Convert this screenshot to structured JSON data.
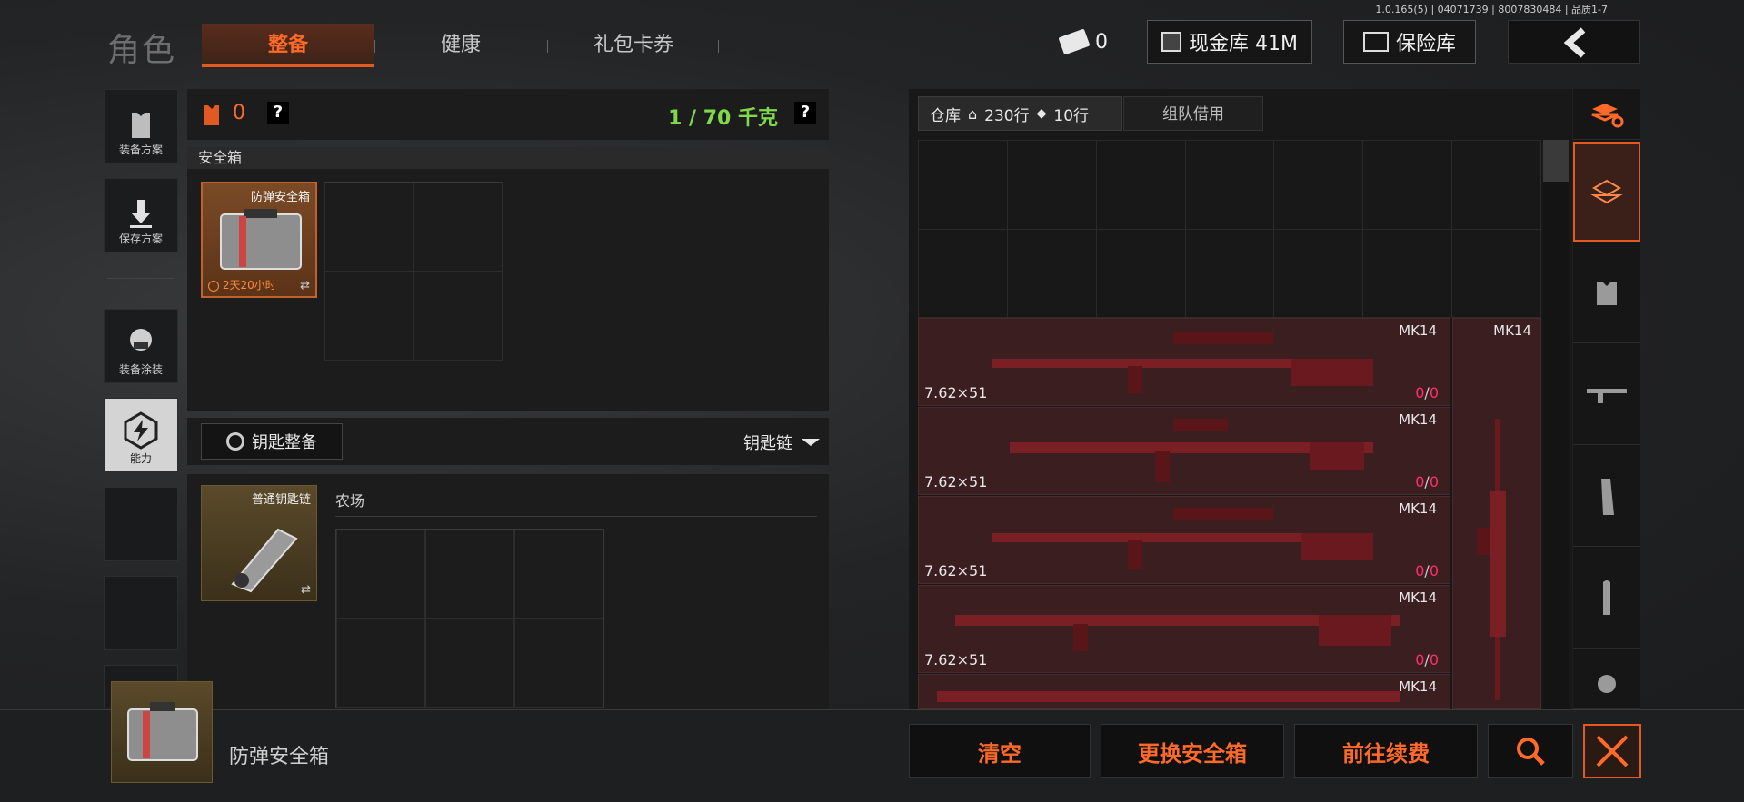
{
  "version_text": "1.0.165(5) | 04071739 | 8007830484 | 品质1-7",
  "header": {
    "role_title": "角色",
    "tabs": [
      "整备",
      "健康",
      "礼包卡券"
    ],
    "ticket_count": "0",
    "cash_label": "现金库 41M",
    "vault_label": "保险库"
  },
  "sidebar": {
    "items": [
      {
        "label": "装备方案",
        "icon": "vest-icon"
      },
      {
        "label": "保存方案",
        "icon": "download-icon"
      },
      {
        "label": "装备涂装",
        "icon": "soldier-icon"
      },
      {
        "label": "能力",
        "icon": "lightning-hex-icon"
      }
    ]
  },
  "loadout": {
    "bag_count": "0",
    "weight": "1 / 70 千克",
    "safe_section_title": "安全箱",
    "safe_item": {
      "name": "防弹安全箱",
      "timer": "2天20小时"
    },
    "key_button": "钥匙整备",
    "key_chain_dropdown": "钥匙链",
    "key_item": {
      "name": "普通钥匙链"
    },
    "key_area": "农场"
  },
  "warehouse": {
    "title": "仓库",
    "rows_home": "230行",
    "rows_tag": "10行",
    "team_borrow": "组队借用",
    "guns": [
      {
        "name": "MK14",
        "ammo": "7.62×51",
        "count": "0",
        "max": "0"
      },
      {
        "name": "MK14",
        "ammo": "7.62×51",
        "count": "0",
        "max": "0"
      },
      {
        "name": "MK14",
        "ammo": "7.62×51",
        "count": "0",
        "max": "0"
      },
      {
        "name": "MK14",
        "ammo": "7.62×51",
        "count": "0",
        "max": "0"
      },
      {
        "name": "MK14",
        "ammo": "",
        "count": "",
        "max": ""
      }
    ],
    "vertical_gun_name": "MK14"
  },
  "bottom": {
    "selected_item": "防弹安全箱",
    "clear": "清空",
    "change_safe": "更换安全箱",
    "renew": "前往续费"
  },
  "colors": {
    "accent": "#ff6a2a",
    "weight_green": "#7fd94a",
    "count_pink": "#ff2f6a"
  }
}
